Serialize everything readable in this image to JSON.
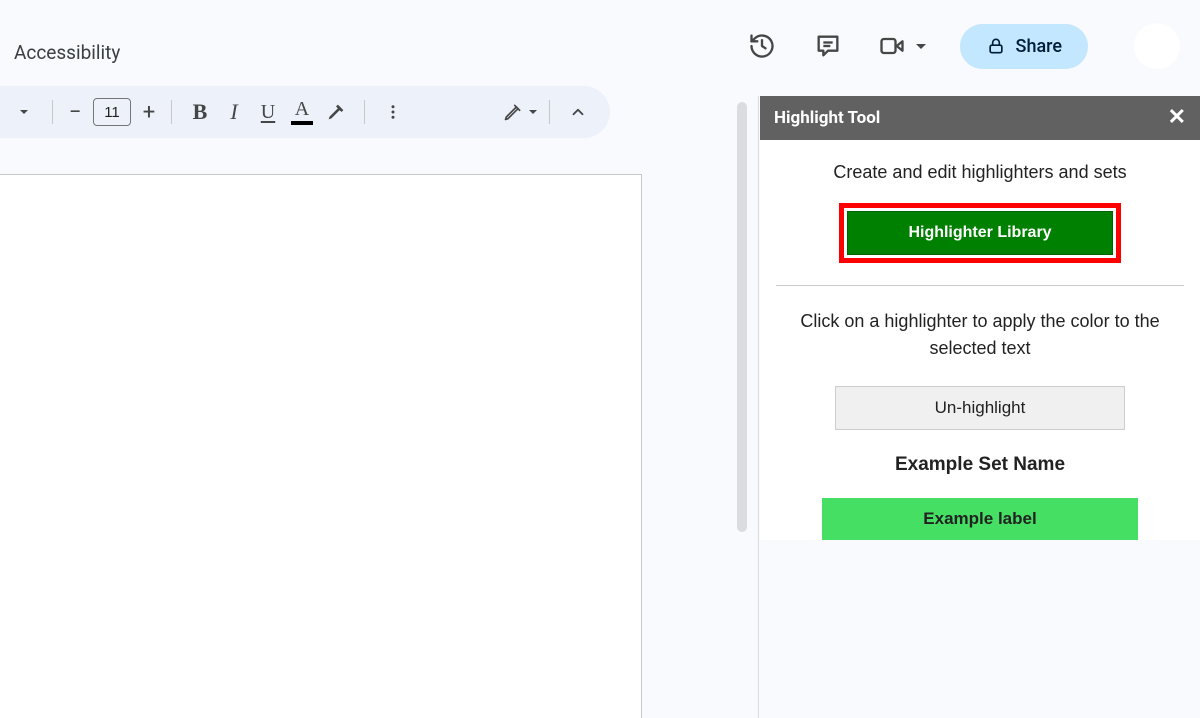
{
  "menubar": {
    "accessibility_label": "Accessibility",
    "share_label": "Share"
  },
  "toolbar": {
    "font_size": "11"
  },
  "panel": {
    "title": "Highlight Tool",
    "desc_create": "Create and edit highlighters and sets",
    "library_label": "Highlighter Library",
    "desc_apply": "Click on a highlighter to apply the color to the selected text",
    "unhighlight_label": "Un-highlight",
    "set_name": "Example Set Name",
    "swatches": [
      {
        "label": "Example label",
        "color": "#45e063"
      }
    ]
  }
}
